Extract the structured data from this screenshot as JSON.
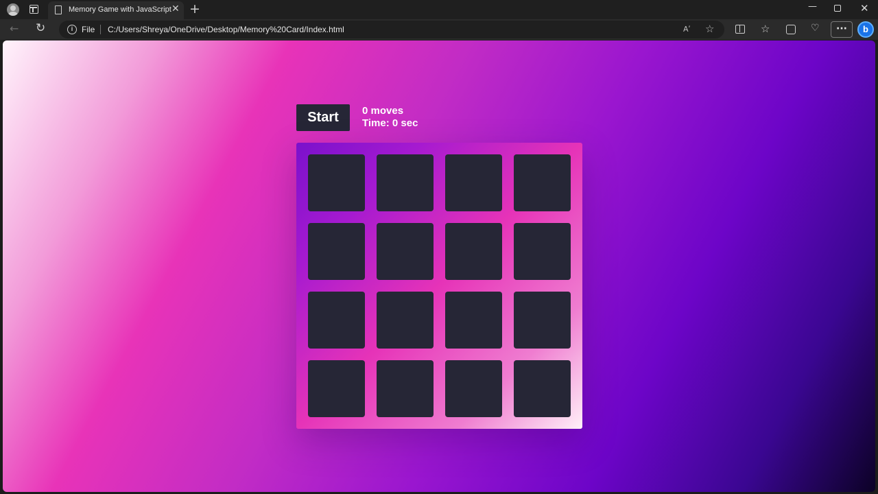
{
  "browser": {
    "tab_title": "Memory Game with JavaScript",
    "tab_close_glyph": "✕",
    "new_tab_glyph": "+",
    "file_label": "File",
    "url": "C:/Users/Shreya/OneDrive/Desktop/Memory%20Card/Index.html",
    "read_aloud_glyph": "Aʹ",
    "more_glyph": "···",
    "bing_letter": "b",
    "icons": [
      "profile-icon",
      "tab-actions-icon",
      "page-icon",
      "back-icon",
      "reload-icon",
      "info-icon",
      "read-aloud-icon",
      "favorite-star-icon",
      "split-screen-icon",
      "favorites-icon",
      "collections-icon",
      "browser-essentials-icon",
      "more-icon",
      "bing-copilot-icon"
    ]
  },
  "game": {
    "start_label": "Start",
    "moves_text": "0 moves",
    "time_text": "Time: 0 sec",
    "card_count": 16,
    "colors": {
      "card": "#262636",
      "button": "#262636",
      "text": "#ffffff"
    }
  }
}
